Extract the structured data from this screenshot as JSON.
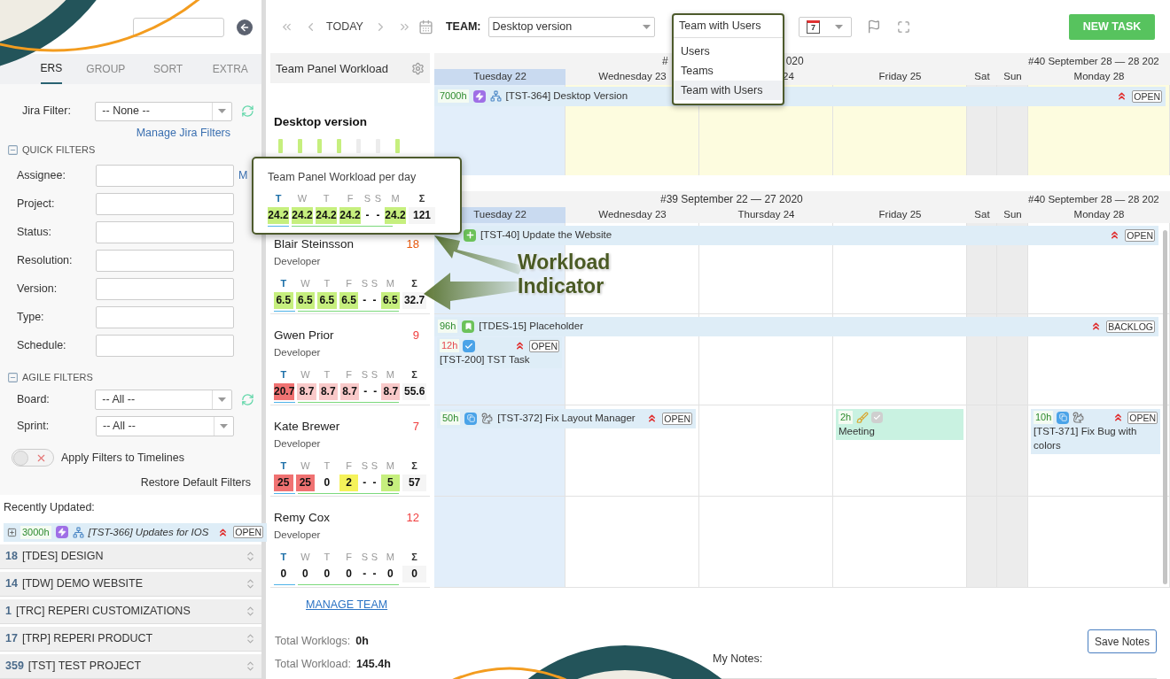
{
  "sidebar": {
    "tabs": [
      {
        "label": "ERS",
        "selected": true
      },
      {
        "label": "GROUP",
        "selected": false
      },
      {
        "label": "SORT",
        "selected": false
      },
      {
        "label": "EXTRA",
        "selected": false
      }
    ],
    "jira_filter": {
      "label": "Jira Filter:",
      "value": "-- None --",
      "link": "Manage Jira Filters"
    },
    "quick_filters": {
      "title": "QUICK FILTERS",
      "expanded": true,
      "more_link": "M",
      "fields": [
        {
          "label": "Assignee:"
        },
        {
          "label": "Project:"
        },
        {
          "label": "Status:"
        },
        {
          "label": "Resolution:"
        },
        {
          "label": "Version:"
        },
        {
          "label": "Type:"
        },
        {
          "label": "Schedule:"
        }
      ]
    },
    "agile_filters": {
      "title": "AGILE FILTERS",
      "expanded": true,
      "selects": [
        {
          "label": "Board:",
          "value": "-- All --",
          "refresh": true
        },
        {
          "label": "Sprint:",
          "value": "-- All --",
          "refresh": false
        }
      ]
    },
    "apply_toggle": {
      "label": "Apply Filters to Timelines",
      "on": false
    },
    "restore_link": "Restore Default Filters",
    "recently_updated": {
      "title": "Recently Updated:",
      "item": {
        "hours": "3000h",
        "kind": "epic",
        "linked": true,
        "title": "[TST-366] Updates for IOS",
        "high_priority": true,
        "status": "OPEN"
      }
    },
    "projects": [
      {
        "count": "18",
        "name": "[TDES] DESIGN"
      },
      {
        "count": "14",
        "name": "[TDW] DEMO WEBSITE"
      },
      {
        "count": "1",
        "name": "[TRC] REPERI CUSTOMIZATIONS"
      },
      {
        "count": "17",
        "name": "[TRP] REPERI PRODUCT"
      },
      {
        "count": "359",
        "name": "[TST] TEST PROJECT"
      }
    ]
  },
  "toolbar": {
    "today": "TODAY",
    "team_label": "TEAM:",
    "team_value": "Desktop version",
    "view_select": {
      "value": "Team with Users",
      "expanded": true,
      "options": [
        {
          "label": "Users",
          "selected": false
        },
        {
          "label": "Teams",
          "selected": false
        },
        {
          "label": "Team with Users",
          "selected": true
        }
      ]
    },
    "calendar_day": "7",
    "new_task": "NEW TASK"
  },
  "team_panel": {
    "title": "Team Panel Workload",
    "team_name": "Desktop version",
    "bars": [
      {
        "filled": true
      },
      {
        "filled": true
      },
      {
        "filled": true
      },
      {
        "filled": true
      },
      {
        "filled": false
      },
      {
        "filled": false
      },
      {
        "filled": true
      }
    ]
  },
  "tooltip": {
    "title": "Team Panel Workload per day",
    "days": [
      {
        "letter": "T",
        "today": true
      },
      {
        "letter": "W",
        "today": false
      },
      {
        "letter": "T",
        "today": false
      },
      {
        "letter": "F",
        "today": false
      },
      {
        "letter": "S",
        "today": false
      },
      {
        "letter": "S",
        "today": false
      },
      {
        "letter": "M",
        "today": false
      }
    ],
    "sum_label": "Σ",
    "values": [
      {
        "text": "24.2",
        "kind": "ok"
      },
      {
        "text": "24.2",
        "kind": "ok"
      },
      {
        "text": "24.2",
        "kind": "ok"
      },
      {
        "text": "24.2",
        "kind": "ok"
      },
      {
        "text": "-",
        "kind": "none"
      },
      {
        "text": "-",
        "kind": "none"
      },
      {
        "text": "24.2",
        "kind": "ok"
      }
    ],
    "total": "121"
  },
  "callout": {
    "title": "Workload Indicator"
  },
  "calendar": {
    "week_labels": [
      {
        "text": "#"
      },
      {
        "text": "020"
      },
      {
        "text": "#40 September 28 — 28 202"
      }
    ],
    "days": [
      {
        "label": "Tuesday 22",
        "today": true,
        "weekend": false
      },
      {
        "label": "Wednesday 23",
        "today": false,
        "weekend": false
      },
      {
        "label": "24",
        "today": false,
        "weekend": false
      },
      {
        "label": "Friday 25",
        "today": false,
        "weekend": false
      },
      {
        "label": "Sat",
        "today": false,
        "weekend": true
      },
      {
        "label": "Sun",
        "today": false,
        "weekend": true
      },
      {
        "label": "Monday 28",
        "today": false,
        "weekend": false
      }
    ],
    "team_bar": {
      "hours": "7000h",
      "kind": "epic",
      "linked": true,
      "title": "[TST-364] Desktop Version",
      "high_priority": true,
      "status": "OPEN"
    },
    "members_week_labels": [
      {
        "text": "#39 September 22 — 27 2020"
      },
      {
        "text": "#40 September 28 — 28 202"
      }
    ],
    "members_days": [
      {
        "label": "Tuesday 22",
        "today": true,
        "weekend": false
      },
      {
        "label": "Wednesday 23",
        "today": false,
        "weekend": false
      },
      {
        "label": "Thursday 24",
        "today": false,
        "weekend": false
      },
      {
        "label": "Friday 25",
        "today": false,
        "weekend": false
      },
      {
        "label": "Sat",
        "today": false,
        "weekend": true
      },
      {
        "label": "Sun",
        "today": false,
        "weekend": true
      },
      {
        "label": "Monday 28",
        "today": false,
        "weekend": false
      }
    ]
  },
  "members": [
    {
      "name": "Blair Steinsson",
      "role": "Developer",
      "count": "18",
      "color": "#e8590c",
      "days": [
        {
          "letter": "T",
          "today": true
        },
        {
          "letter": "W",
          "today": false
        },
        {
          "letter": "T",
          "today": false
        },
        {
          "letter": "F",
          "today": false
        },
        {
          "letter": "S",
          "today": false
        },
        {
          "letter": "S",
          "today": false
        },
        {
          "letter": "M",
          "today": false
        }
      ],
      "sum_label": "Σ",
      "values": [
        {
          "text": "6.5",
          "kind": "ok"
        },
        {
          "text": "6.5",
          "kind": "ok"
        },
        {
          "text": "6.5",
          "kind": "ok"
        },
        {
          "text": "6.5",
          "kind": "ok"
        },
        {
          "text": "-",
          "kind": "none"
        },
        {
          "text": "-",
          "kind": "none"
        },
        {
          "text": "6.5",
          "kind": "ok"
        }
      ],
      "total": "32.7",
      "bar": {
        "kind": "story",
        "title": "[TST-40] Update the Website",
        "high_priority": true,
        "status": "OPEN"
      },
      "cells": [
        {},
        {},
        {},
        {},
        {},
        {},
        {}
      ]
    },
    {
      "name": "Gwen Prior",
      "role": "Developer",
      "count": "9",
      "color": "#f03e3e",
      "days": [
        {
          "letter": "T",
          "today": true
        },
        {
          "letter": "W",
          "today": false
        },
        {
          "letter": "T",
          "today": false
        },
        {
          "letter": "F",
          "today": false
        },
        {
          "letter": "S",
          "today": false
        },
        {
          "letter": "S",
          "today": false
        },
        {
          "letter": "M",
          "today": false
        }
      ],
      "sum_label": "Σ",
      "values": [
        {
          "text": "20.7",
          "kind": "high"
        },
        {
          "text": "8.7",
          "kind": "over"
        },
        {
          "text": "8.7",
          "kind": "over"
        },
        {
          "text": "8.7",
          "kind": "over"
        },
        {
          "text": "-",
          "kind": "none"
        },
        {
          "text": "-",
          "kind": "none"
        },
        {
          "text": "8.7",
          "kind": "over"
        }
      ],
      "total": "55.6",
      "bar": {
        "hours": "96h",
        "kind": "bookmark",
        "title": "[TDES-15] Placeholder",
        "high_priority": true,
        "status": "BACKLOG"
      },
      "cells": [
        {
          "tasks": [
            {
              "hours": "12h",
              "overdue": true,
              "kind": "task",
              "title": "[TST-200] TST Task",
              "high_priority": true,
              "status": "OPEN"
            }
          ]
        },
        {},
        {},
        {},
        {},
        {},
        {}
      ]
    },
    {
      "name": "Kate Brewer",
      "role": "Developer",
      "count": "7",
      "color": "#f03e3e",
      "days": [
        {
          "letter": "T",
          "today": true
        },
        {
          "letter": "W",
          "today": false
        },
        {
          "letter": "T",
          "today": false
        },
        {
          "letter": "F",
          "today": false
        },
        {
          "letter": "S",
          "today": false
        },
        {
          "letter": "S",
          "today": false
        },
        {
          "letter": "M",
          "today": false
        }
      ],
      "sum_label": "Σ",
      "values": [
        {
          "text": "25",
          "kind": "high"
        },
        {
          "text": "25",
          "kind": "high"
        },
        {
          "text": "0",
          "kind": "none"
        },
        {
          "text": "2",
          "kind": "low"
        },
        {
          "text": "-",
          "kind": "none"
        },
        {
          "text": "-",
          "kind": "none"
        },
        {
          "text": "5",
          "kind": "ok"
        }
      ],
      "total": "57",
      "cells": [
        {
          "tasks": [
            {
              "hours": "50h",
              "kind": "subtask",
              "watcher": true,
              "title": "[TST-372] Fix Layout Manager",
              "high_priority": true,
              "status": "OPEN",
              "wide": true
            }
          ]
        },
        {},
        {},
        {
          "tasks": [
            {
              "hours": "2h",
              "kind": "meeting",
              "title": "Meeting"
            }
          ]
        },
        {},
        {},
        {
          "tasks": [
            {
              "hours": "10h",
              "kind": "subtask",
              "watcher": true,
              "title": "[TST-371] Fix Bug with colors",
              "high_priority": true,
              "status": "OPEN"
            }
          ]
        }
      ]
    },
    {
      "name": "Remy Cox",
      "role": "Developer",
      "count": "12",
      "color": "#f03e3e",
      "days": [
        {
          "letter": "T",
          "today": true
        },
        {
          "letter": "W",
          "today": false
        },
        {
          "letter": "T",
          "today": false
        },
        {
          "letter": "F",
          "today": false
        },
        {
          "letter": "S",
          "today": false
        },
        {
          "letter": "S",
          "today": false
        },
        {
          "letter": "M",
          "today": false
        }
      ],
      "sum_label": "Σ",
      "values": [
        {
          "text": "0",
          "kind": "none"
        },
        {
          "text": "0",
          "kind": "none"
        },
        {
          "text": "0",
          "kind": "none"
        },
        {
          "text": "0",
          "kind": "none"
        },
        {
          "text": "-",
          "kind": "none"
        },
        {
          "text": "-",
          "kind": "none"
        },
        {
          "text": "0",
          "kind": "none"
        }
      ],
      "total": "0",
      "cells": [
        {},
        {},
        {},
        {},
        {},
        {},
        {}
      ]
    }
  ],
  "footer": {
    "manage_team": "MANAGE TEAM",
    "totals": [
      {
        "label": "Total Worklogs:",
        "value": "0h"
      },
      {
        "label": "Total Workload:",
        "value": "145.4h"
      }
    ],
    "save_notes": "Save Notes",
    "notes_label": "My Notes:"
  }
}
